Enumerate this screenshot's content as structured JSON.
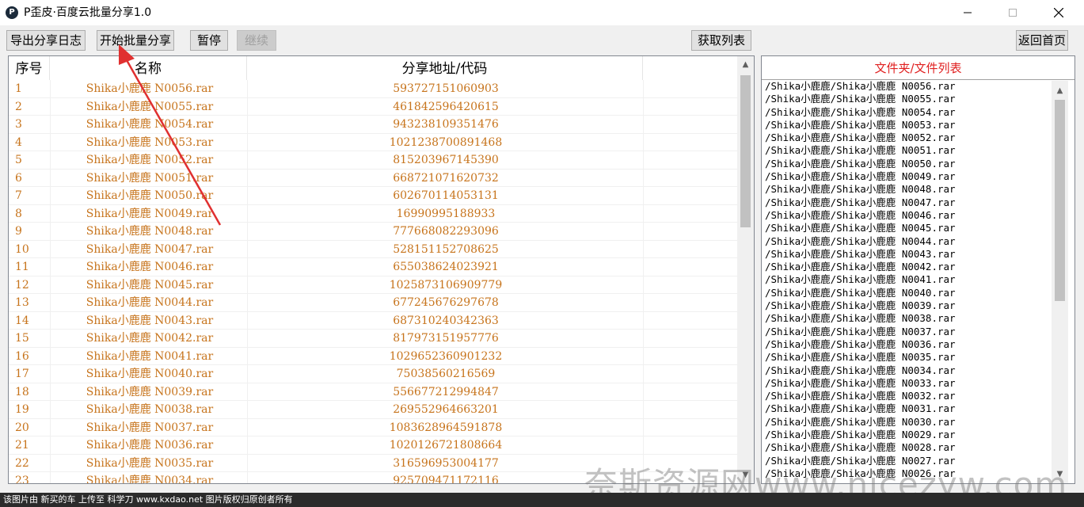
{
  "window": {
    "title": "P歪皮·百度云批量分享1.0",
    "icon_letter": "P"
  },
  "toolbar": {
    "export_log": "导出分享日志",
    "start_batch": "开始批量分享",
    "pause": "暂停",
    "resume": "继续",
    "fetch_list": "获取列表",
    "back_home": "返回首页"
  },
  "grid": {
    "headers": {
      "index": "序号",
      "name": "名称",
      "code": "分享地址/代码"
    },
    "rows": [
      {
        "idx": "1",
        "name": "Shika小鹿鹿 N0056.rar",
        "code": "593727151060903"
      },
      {
        "idx": "2",
        "name": "Shika小鹿鹿 N0055.rar",
        "code": "461842596420615"
      },
      {
        "idx": "3",
        "name": "Shika小鹿鹿 N0054.rar",
        "code": "943238109351476"
      },
      {
        "idx": "4",
        "name": "Shika小鹿鹿 N0053.rar",
        "code": "1021238700891468"
      },
      {
        "idx": "5",
        "name": "Shika小鹿鹿 N0052.rar",
        "code": "815203967145390"
      },
      {
        "idx": "6",
        "name": "Shika小鹿鹿 N0051.rar",
        "code": "668721071620732"
      },
      {
        "idx": "7",
        "name": "Shika小鹿鹿 N0050.rar",
        "code": "602670114053131"
      },
      {
        "idx": "8",
        "name": "Shika小鹿鹿 N0049.rar",
        "code": "16990995188933"
      },
      {
        "idx": "9",
        "name": "Shika小鹿鹿 N0048.rar",
        "code": "777668082293096"
      },
      {
        "idx": "10",
        "name": "Shika小鹿鹿 N0047.rar",
        "code": "528151152708625"
      },
      {
        "idx": "11",
        "name": "Shika小鹿鹿 N0046.rar",
        "code": "655038624023921"
      },
      {
        "idx": "12",
        "name": "Shika小鹿鹿 N0045.rar",
        "code": "1025873106909779"
      },
      {
        "idx": "13",
        "name": "Shika小鹿鹿 N0044.rar",
        "code": "677245676297678"
      },
      {
        "idx": "14",
        "name": "Shika小鹿鹿 N0043.rar",
        "code": "687310240342363"
      },
      {
        "idx": "15",
        "name": "Shika小鹿鹿 N0042.rar",
        "code": "817973151957776"
      },
      {
        "idx": "16",
        "name": "Shika小鹿鹿 N0041.rar",
        "code": "1029652360901232"
      },
      {
        "idx": "17",
        "name": "Shika小鹿鹿 N0040.rar",
        "code": "75038560216569"
      },
      {
        "idx": "18",
        "name": "Shika小鹿鹿 N0039.rar",
        "code": "556677212994847"
      },
      {
        "idx": "19",
        "name": "Shika小鹿鹿 N0038.rar",
        "code": "269552964663201"
      },
      {
        "idx": "20",
        "name": "Shika小鹿鹿 N0037.rar",
        "code": "1083628964591878"
      },
      {
        "idx": "21",
        "name": "Shika小鹿鹿 N0036.rar",
        "code": "1020126721808664"
      },
      {
        "idx": "22",
        "name": "Shika小鹿鹿 N0035.rar",
        "code": "316596953004177"
      },
      {
        "idx": "23",
        "name": "Shika小鹿鹿 N0034.rar",
        "code": "925709471172116"
      }
    ]
  },
  "file_list": {
    "title": "文件夹/文件列表",
    "items": [
      "/Shika小鹿鹿/Shika小鹿鹿 N0056.rar",
      "/Shika小鹿鹿/Shika小鹿鹿 N0055.rar",
      "/Shika小鹿鹿/Shika小鹿鹿 N0054.rar",
      "/Shika小鹿鹿/Shika小鹿鹿 N0053.rar",
      "/Shika小鹿鹿/Shika小鹿鹿 N0052.rar",
      "/Shika小鹿鹿/Shika小鹿鹿 N0051.rar",
      "/Shika小鹿鹿/Shika小鹿鹿 N0050.rar",
      "/Shika小鹿鹿/Shika小鹿鹿 N0049.rar",
      "/Shika小鹿鹿/Shika小鹿鹿 N0048.rar",
      "/Shika小鹿鹿/Shika小鹿鹿 N0047.rar",
      "/Shika小鹿鹿/Shika小鹿鹿 N0046.rar",
      "/Shika小鹿鹿/Shika小鹿鹿 N0045.rar",
      "/Shika小鹿鹿/Shika小鹿鹿 N0044.rar",
      "/Shika小鹿鹿/Shika小鹿鹿 N0043.rar",
      "/Shika小鹿鹿/Shika小鹿鹿 N0042.rar",
      "/Shika小鹿鹿/Shika小鹿鹿 N0041.rar",
      "/Shika小鹿鹿/Shika小鹿鹿 N0040.rar",
      "/Shika小鹿鹿/Shika小鹿鹿 N0039.rar",
      "/Shika小鹿鹿/Shika小鹿鹿 N0038.rar",
      "/Shika小鹿鹿/Shika小鹿鹿 N0037.rar",
      "/Shika小鹿鹿/Shika小鹿鹿 N0036.rar",
      "/Shika小鹿鹿/Shika小鹿鹿 N0035.rar",
      "/Shika小鹿鹿/Shika小鹿鹿 N0034.rar",
      "/Shika小鹿鹿/Shika小鹿鹿 N0033.rar",
      "/Shika小鹿鹿/Shika小鹿鹿 N0032.rar",
      "/Shika小鹿鹿/Shika小鹿鹿 N0031.rar",
      "/Shika小鹿鹿/Shika小鹿鹿 N0030.rar",
      "/Shika小鹿鹿/Shika小鹿鹿 N0029.rar",
      "/Shika小鹿鹿/Shika小鹿鹿 N0028.rar",
      "/Shika小鹿鹿/Shika小鹿鹿 N0027.rar",
      "/Shika小鹿鹿/Shika小鹿鹿 N0026.rar"
    ]
  },
  "watermark": "奈斯资源网www.nicezyw.com",
  "status_text": "该图片由 新买的车 上传至 科学刀 www.kxdao.net 图片版权归原创者所有",
  "colors": {
    "row_text": "#c7741c",
    "list_title": "#e02020",
    "annotation_arrow": "#e03030"
  }
}
